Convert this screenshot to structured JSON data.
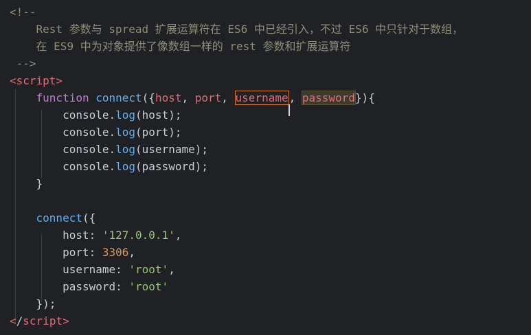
{
  "editor": {
    "colors": {
      "background": "#1f2125",
      "comment": "#8c8f7a",
      "tag": "#e06c75",
      "keyword": "#c678dd",
      "function": "#61afef",
      "variable": "#e06c75",
      "plain": "#c8ccd4",
      "string": "#98c379",
      "number": "#d19a66"
    },
    "lines": [
      {
        "tokens": [
          {
            "t": "<!--",
            "c": "comment"
          }
        ]
      },
      {
        "tokens": [
          {
            "t": "    Rest 参数与 spread 扩展运算符在 ES6 中已经引入，不过 ES6 中只针对于数组，",
            "c": "comment"
          }
        ]
      },
      {
        "tokens": [
          {
            "t": "    在 ES9 中为对象提供了像数组一样的 rest 参数和扩展运算符",
            "c": "comment"
          }
        ]
      },
      {
        "tokens": [
          {
            "t": " -->",
            "c": "comment"
          }
        ]
      },
      {
        "tokens": [
          {
            "t": "<script>",
            "c": "tag"
          }
        ]
      },
      {
        "tokens": [
          {
            "t": "    ",
            "c": "plain"
          },
          {
            "t": "function",
            "c": "keyword"
          },
          {
            "t": " ",
            "c": "plain"
          },
          {
            "t": "connect",
            "c": "function"
          },
          {
            "t": "({",
            "c": "plain"
          },
          {
            "t": "host",
            "c": "variable"
          },
          {
            "t": ", ",
            "c": "plain"
          },
          {
            "t": "port",
            "c": "variable"
          },
          {
            "t": ", ",
            "c": "plain"
          },
          {
            "t": "username",
            "c": "variable",
            "mark": "sel"
          },
          {
            "t": "",
            "c": "plain",
            "mark": "cursor"
          },
          {
            "t": ", ",
            "c": "plain"
          },
          {
            "t": "password",
            "c": "variable",
            "mark": "hl"
          },
          {
            "t": "}){",
            "c": "plain"
          }
        ]
      },
      {
        "tokens": [
          {
            "t": "        console.",
            "c": "plain"
          },
          {
            "t": "log",
            "c": "function"
          },
          {
            "t": "(host);",
            "c": "plain"
          }
        ]
      },
      {
        "tokens": [
          {
            "t": "        console.",
            "c": "plain"
          },
          {
            "t": "log",
            "c": "function"
          },
          {
            "t": "(port);",
            "c": "plain"
          }
        ]
      },
      {
        "tokens": [
          {
            "t": "        console.",
            "c": "plain"
          },
          {
            "t": "log",
            "c": "function"
          },
          {
            "t": "(username);",
            "c": "plain"
          }
        ]
      },
      {
        "tokens": [
          {
            "t": "        console.",
            "c": "plain"
          },
          {
            "t": "log",
            "c": "function"
          },
          {
            "t": "(password);",
            "c": "plain"
          }
        ]
      },
      {
        "tokens": [
          {
            "t": "    }",
            "c": "plain"
          }
        ]
      },
      {
        "tokens": [
          {
            "t": "",
            "c": "plain"
          }
        ]
      },
      {
        "tokens": [
          {
            "t": "    ",
            "c": "plain"
          },
          {
            "t": "connect",
            "c": "function"
          },
          {
            "t": "({",
            "c": "plain"
          }
        ]
      },
      {
        "tokens": [
          {
            "t": "        host: ",
            "c": "plain"
          },
          {
            "t": "'127.0.0.1'",
            "c": "string"
          },
          {
            "t": ",",
            "c": "plain"
          }
        ]
      },
      {
        "tokens": [
          {
            "t": "        port: ",
            "c": "plain"
          },
          {
            "t": "3306",
            "c": "number"
          },
          {
            "t": ",",
            "c": "plain"
          }
        ]
      },
      {
        "tokens": [
          {
            "t": "        username: ",
            "c": "plain"
          },
          {
            "t": "'root'",
            "c": "string"
          },
          {
            "t": ",",
            "c": "plain"
          }
        ]
      },
      {
        "tokens": [
          {
            "t": "        password: ",
            "c": "plain"
          },
          {
            "t": "'root'",
            "c": "string"
          }
        ]
      },
      {
        "tokens": [
          {
            "t": "    });",
            "c": "plain"
          }
        ]
      },
      {
        "tokens": [
          {
            "t": "<",
            "c": "tag"
          },
          {
            "t": "/",
            "c": "plain"
          },
          {
            "t": "script>",
            "c": "tag"
          }
        ]
      }
    ]
  }
}
